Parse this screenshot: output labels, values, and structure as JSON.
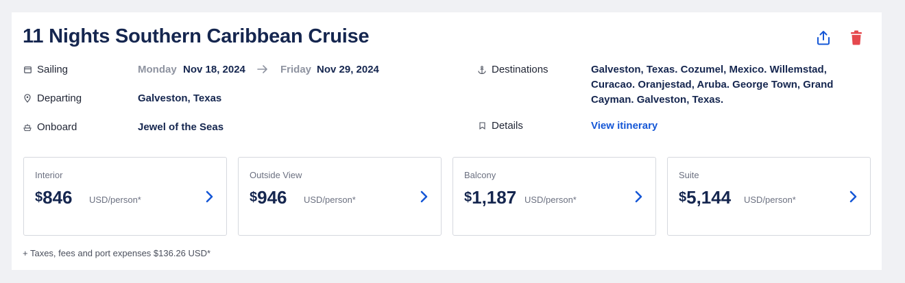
{
  "cruise": {
    "title": "11 Nights Southern Caribbean Cruise"
  },
  "actions": {
    "share_icon": "share-icon",
    "delete_icon": "trash-icon",
    "delete_color": "#e5484d"
  },
  "sailing": {
    "label": "Sailing",
    "start_day": "Monday",
    "start_date": "Nov 18, 2024",
    "end_day": "Friday",
    "end_date": "Nov 29, 2024"
  },
  "departing": {
    "label": "Departing",
    "value": "Galveston, Texas"
  },
  "onboard": {
    "label": "Onboard",
    "value": "Jewel of the Seas"
  },
  "destinations": {
    "label": "Destinations",
    "value": "Galveston, Texas. Cozumel, Mexico. Willemstad, Curacao. Oranjestad, Aruba. George Town, Grand Cayman. Galveston, Texas."
  },
  "details": {
    "label": "Details",
    "link": "View itinerary"
  },
  "prices": [
    {
      "category": "Interior",
      "currency": "$",
      "amount": "846",
      "unit": "USD/person*"
    },
    {
      "category": "Outside View",
      "currency": "$",
      "amount": "946",
      "unit": "USD/person*"
    },
    {
      "category": "Balcony",
      "currency": "$",
      "amount": "1,187",
      "unit": "USD/person*"
    },
    {
      "category": "Suite",
      "currency": "$",
      "amount": "5,144",
      "unit": "USD/person*"
    }
  ],
  "taxes_note": "+ Taxes, fees and port expenses $136.26 USD*",
  "colors": {
    "title": "#15264f",
    "link": "#1557d6",
    "muted": "#8e93a0"
  }
}
